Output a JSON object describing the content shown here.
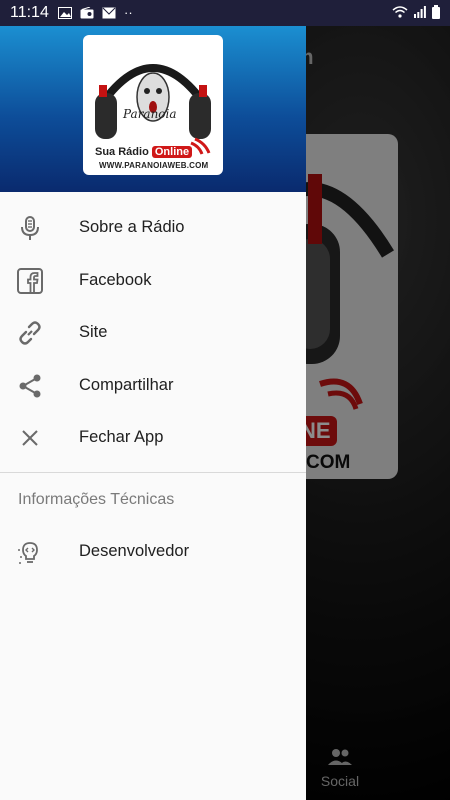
{
  "status_bar": {
    "time": "11:14",
    "left_icons": [
      "image-icon",
      "radio-icon",
      "mail-icon",
      "more-dots-icon"
    ],
    "right_icons": [
      "wifi-icon",
      "signal-icon",
      "battery-icon"
    ],
    "more_dots": "··"
  },
  "background_app": {
    "title_fragment": "om",
    "cover_online": "NE",
    "cover_domain": "COM",
    "bottom_nav": {
      "social_label": "Social"
    }
  },
  "drawer": {
    "logo": {
      "brand": "Paranoia",
      "tagline_prefix": "Sua Rádio",
      "tagline_online": "Online",
      "url": "WWW.PARANOIAWEB.COM"
    },
    "menu_items": [
      {
        "label": "Sobre a Rádio",
        "icon": "microphone-icon"
      },
      {
        "label": "Facebook",
        "icon": "facebook-icon"
      },
      {
        "label": "Site",
        "icon": "link-icon"
      },
      {
        "label": "Compartilhar",
        "icon": "share-icon"
      },
      {
        "label": "Fechar App",
        "icon": "close-icon"
      }
    ],
    "section_title": "Informações Técnicas",
    "developer_item": {
      "label": "Desenvolvedor",
      "icon": "developer-icon"
    }
  },
  "colors": {
    "header_top": "#1b8fd1",
    "header_bottom": "#0a2a6e",
    "drawer_bg": "#fafafa",
    "status_bar": "#1f1f3a",
    "accent_red": "#d01818"
  }
}
